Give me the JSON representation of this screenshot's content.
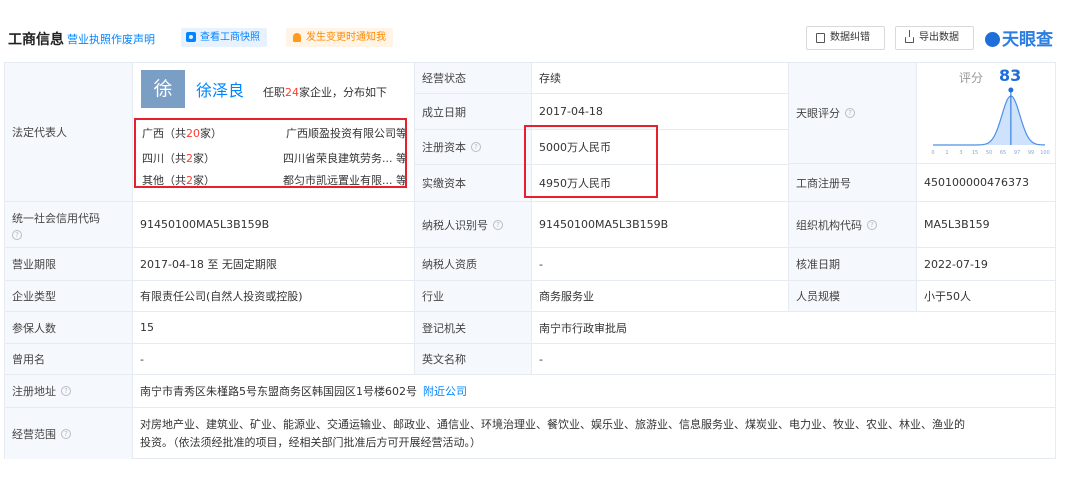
{
  "header": {
    "title": "工商信息",
    "license_link": "营业执照作废声明",
    "snapshot_button": "查看工商快照",
    "notify_button": "发生变更时通知我",
    "correct_button": "数据纠错",
    "export_button": "导出数据",
    "logo_text": "天眼查"
  },
  "legal_rep": {
    "label": "法定代表人",
    "avatar": "徐",
    "name": "徐泽良",
    "info_prefix": "任职",
    "info_count": "24",
    "info_suffix": "家企业，分布如下",
    "regions": [
      {
        "region_prefix": "广西（共",
        "count": "20",
        "region_suffix": "家）",
        "company": "广西顺盈投资有限公司等"
      },
      {
        "region_prefix": "四川（共",
        "count": "2",
        "region_suffix": "家）",
        "company": "四川省荣良建筑劳务...  等"
      },
      {
        "region_prefix": "其他（共",
        "count": "2",
        "region_suffix": "家）",
        "company": "都匀市凯远置业有限...  等"
      }
    ]
  },
  "fields": {
    "status_label": "经营状态",
    "status_value": "存续",
    "established_label": "成立日期",
    "established_value": "2017-04-18",
    "reg_capital_label": "注册资本",
    "reg_capital_value": "5000万人民币",
    "paid_capital_label": "实缴资本",
    "paid_capital_value": "4950万人民币",
    "score_label": "天眼评分",
    "reg_no_label": "工商注册号",
    "reg_no_value": "450100000476373",
    "credit_code_label": "统一社会信用代码",
    "credit_code_value": "91450100MA5L3B159B",
    "taxpayer_id_label": "纳税人识别号",
    "taxpayer_id_value": "91450100MA5L3B159B",
    "org_code_label": "组织机构代码",
    "org_code_value": "MA5L3B159",
    "term_label": "营业期限",
    "term_value": "2017-04-18 至 无固定期限",
    "taxpayer_quality_label": "纳税人资质",
    "taxpayer_quality_value": "-",
    "approval_date_label": "核准日期",
    "approval_date_value": "2022-07-19",
    "type_label": "企业类型",
    "type_value": "有限责任公司(自然人投资或控股)",
    "industry_label": "行业",
    "industry_value": "商务服务业",
    "staff_label": "人员规模",
    "staff_value": "小于50人",
    "insured_label": "参保人数",
    "insured_value": "15",
    "authority_label": "登记机关",
    "authority_value": "南宁市行政审批局",
    "former_name_label": "曾用名",
    "former_name_value": "-",
    "english_name_label": "英文名称",
    "english_name_value": "-",
    "address_label": "注册地址",
    "address_value": "南宁市青秀区朱槿路5号东盟商务区韩国园区1号楼602号",
    "nearby_link": "附近公司",
    "scope_label": "经营范围",
    "scope_line1": "对房地产业、建筑业、矿业、能源业、交通运输业、邮政业、通信业、环境治理业、餐饮业、娱乐业、旅游业、信息服务业、煤炭业、电力业、牧业、农业、林业、渔业的",
    "scope_line2": "投资。（依法须经批准的项目，经相关部门批准后方可开展经营活动。）"
  },
  "score": {
    "label": "评分",
    "value": "83",
    "value_num": 83,
    "ticks": [
      "0",
      "1",
      "3",
      "15",
      "50",
      "65",
      "97",
      "99",
      "100"
    ]
  },
  "colors": {
    "accent": "#0084ff",
    "highlight": "#e8202e",
    "label_bg": "#f5f8fc"
  }
}
